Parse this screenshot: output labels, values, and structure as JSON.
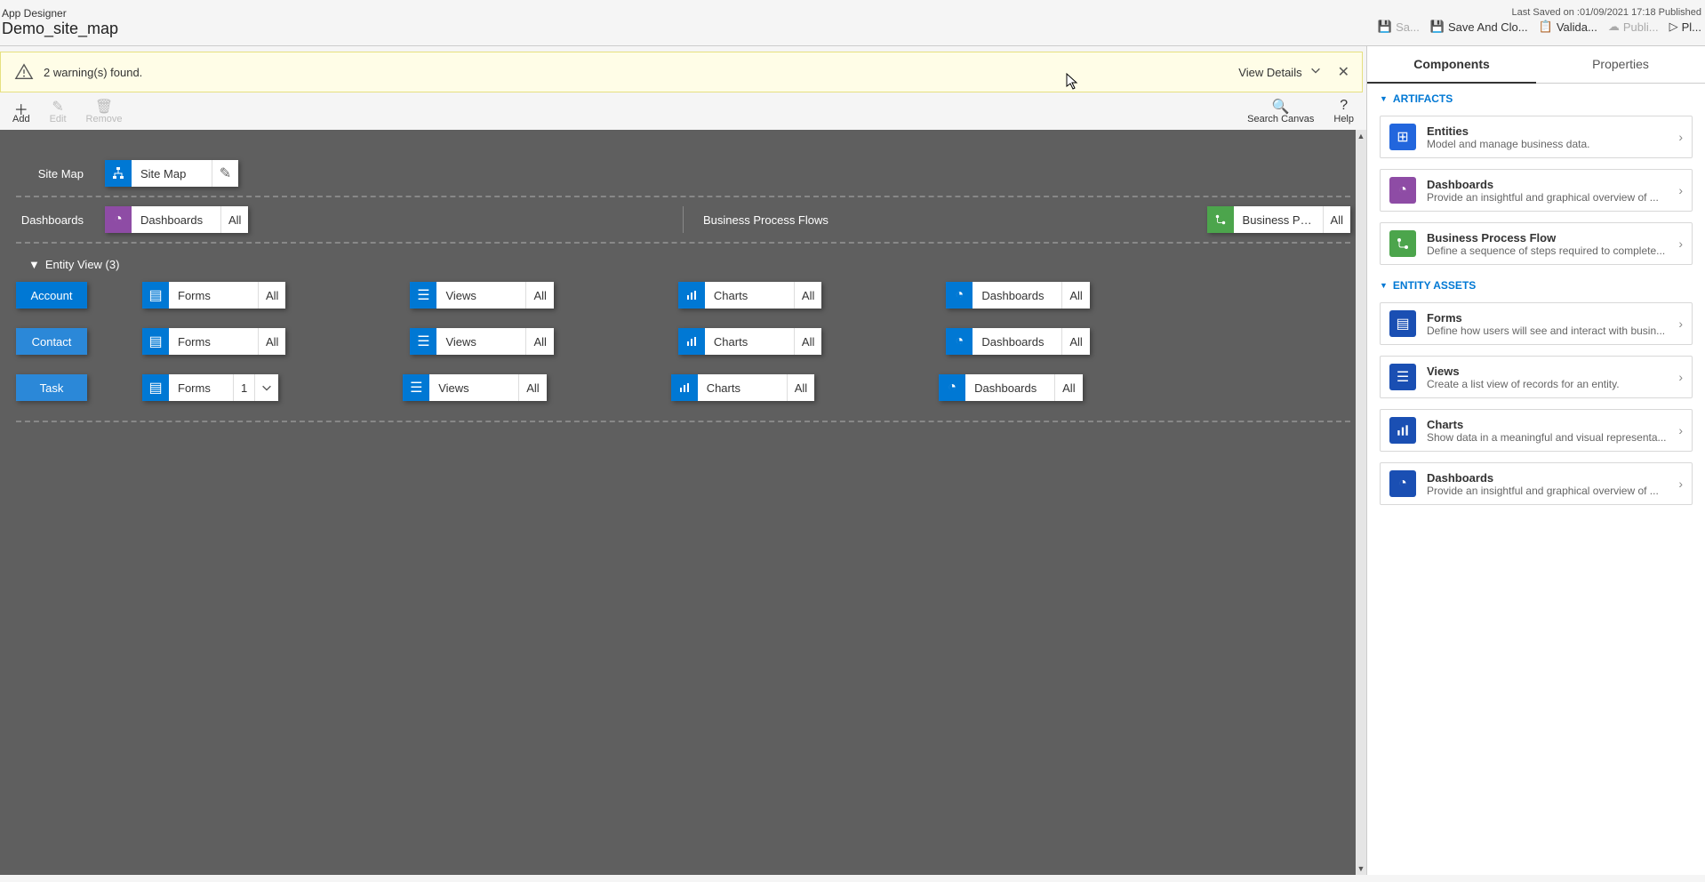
{
  "header": {
    "app_title": "App Designer",
    "app_name": "Demo_site_map",
    "last_saved": "Last Saved on :01/09/2021 17:18 Published",
    "actions": {
      "save": "Sa...",
      "save_close": "Save And Clo...",
      "validate": "Valida...",
      "publish": "Publi...",
      "play": "Pl..."
    }
  },
  "warning": {
    "text": "2 warning(s) found.",
    "view_details": "View Details"
  },
  "toolbar": {
    "add": "Add",
    "edit": "Edit",
    "remove": "Remove",
    "search": "Search Canvas",
    "help": "Help"
  },
  "canvas": {
    "sitemap_label": "Site Map",
    "sitemap_tile": "Site Map",
    "dashboards_label": "Dashboards",
    "dashboards_tile": "Dashboards",
    "bpf_label": "Business Process Flows",
    "bpf_tile": "Business Proces...",
    "all": "All",
    "entity_view_header": "Entity View (3)",
    "entities": [
      {
        "name": "Account",
        "forms_count": "All"
      },
      {
        "name": "Contact",
        "forms_count": "All"
      },
      {
        "name": "Task",
        "forms_count": "1"
      }
    ],
    "asset_labels": {
      "forms": "Forms",
      "views": "Views",
      "charts": "Charts",
      "dashboards": "Dashboards"
    }
  },
  "sidebar": {
    "tabs": {
      "components": "Components",
      "properties": "Properties"
    },
    "artifacts_header": "ARTIFACTS",
    "entity_assets_header": "ENTITY ASSETS",
    "components": {
      "entities": {
        "title": "Entities",
        "desc": "Model and manage business data."
      },
      "dashboards": {
        "title": "Dashboards",
        "desc": "Provide an insightful and graphical overview of ..."
      },
      "bpf": {
        "title": "Business Process Flow",
        "desc": "Define a sequence of steps required to complete..."
      },
      "forms": {
        "title": "Forms",
        "desc": "Define how users will see and interact with busin..."
      },
      "views": {
        "title": "Views",
        "desc": "Create a list view of records for an entity."
      },
      "charts": {
        "title": "Charts",
        "desc": "Show data in a meaningful and visual representa..."
      },
      "dashboards2": {
        "title": "Dashboards",
        "desc": "Provide an insightful and graphical overview of ..."
      }
    }
  }
}
